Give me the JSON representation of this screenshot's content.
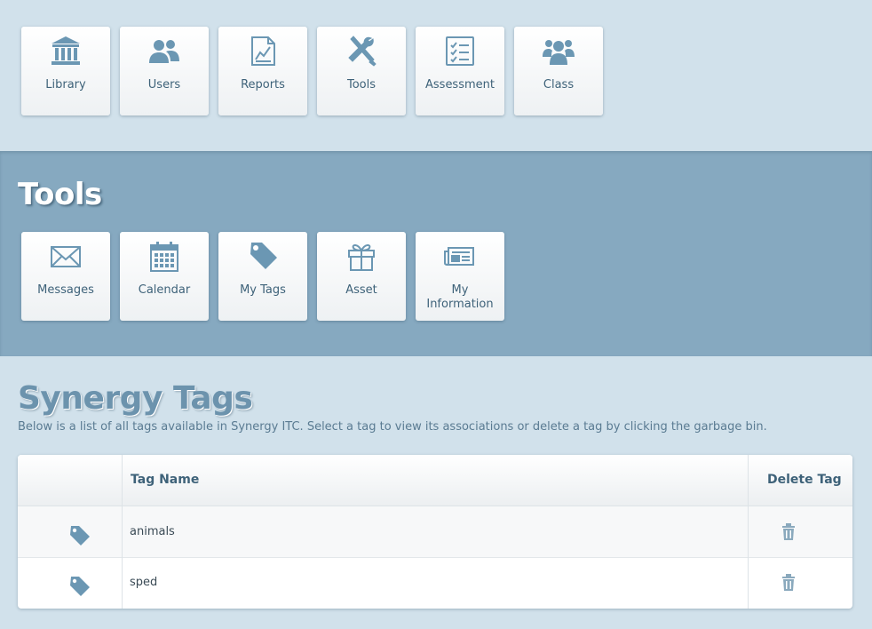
{
  "main_nav": [
    {
      "label": "Library",
      "icon": "library-icon"
    },
    {
      "label": "Users",
      "icon": "users-icon"
    },
    {
      "label": "Reports",
      "icon": "reports-icon"
    },
    {
      "label": "Tools",
      "icon": "tools-icon"
    },
    {
      "label": "Assessment",
      "icon": "assessment-icon"
    },
    {
      "label": "Class",
      "icon": "class-icon"
    }
  ],
  "tools": {
    "title": "Tools",
    "items": [
      {
        "label": "Messages",
        "icon": "envelope-icon"
      },
      {
        "label": "Calendar",
        "icon": "calendar-icon"
      },
      {
        "label": "My Tags",
        "icon": "tag-icon"
      },
      {
        "label": "Asset",
        "icon": "gift-icon"
      },
      {
        "label_line1": "My",
        "label_line2": "Information",
        "icon": "newspaper-icon"
      }
    ]
  },
  "tags": {
    "title": "Synergy Tags",
    "description": "Below is a list of all tags available in Synergy ITC. Select a tag to view its associations or delete a tag by clicking the garbage bin.",
    "columns": {
      "name": "Tag Name",
      "delete": "Delete Tag"
    },
    "rows": [
      {
        "name": "animals"
      },
      {
        "name": "sped"
      }
    ]
  },
  "colors": {
    "page_bg": "#d1e1eb",
    "tools_bg": "#86a9c0",
    "icon": "#6b97b3",
    "label": "#3e6279"
  }
}
